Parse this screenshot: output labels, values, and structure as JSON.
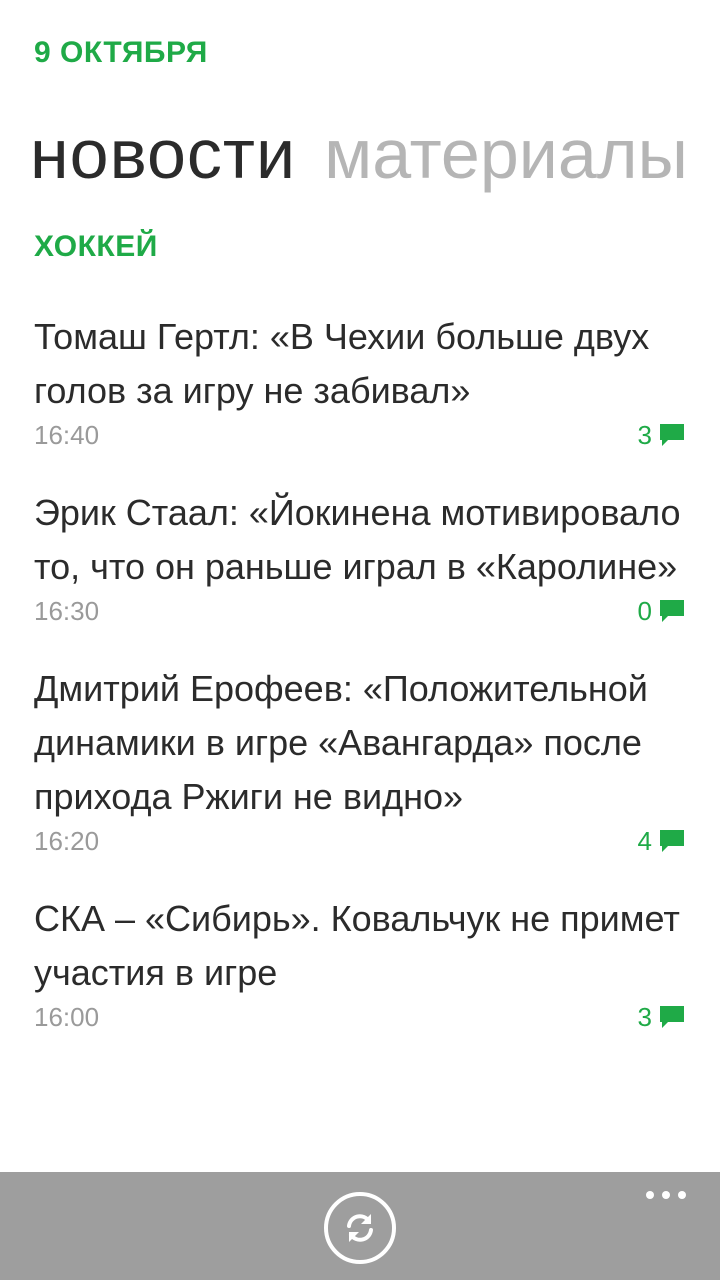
{
  "header": {
    "date": "9 ОКТЯБРЯ",
    "pivot_active": "новости",
    "pivot_next": "материалы"
  },
  "section": {
    "title": "ХОККЕЙ"
  },
  "news": [
    {
      "title": "Томаш Гертл: «В Чехии больше двух голов за игру не забивал»",
      "time": "16:40",
      "comments": "3"
    },
    {
      "title": "Эрик Стаал: «Йокинена мотивировало то, что он раньше играл в «Каролине»",
      "time": "16:30",
      "comments": "0"
    },
    {
      "title": "Дмитрий Ерофеев: «Положительной динамики в игре «Авангарда» после прихода Ржиги не видно»",
      "time": "16:20",
      "comments": "4"
    },
    {
      "title": "СКА – «Сибирь». Ковальчук не примет участия в игре",
      "time": "16:00",
      "comments": "3"
    }
  ],
  "appbar": {
    "refresh_icon": "refresh-icon",
    "more_icon": "more-icon"
  },
  "colors": {
    "accent": "#1faa47",
    "appbar": "#9e9e9e",
    "text": "#2b2b2b",
    "muted": "#9a9a9a"
  }
}
